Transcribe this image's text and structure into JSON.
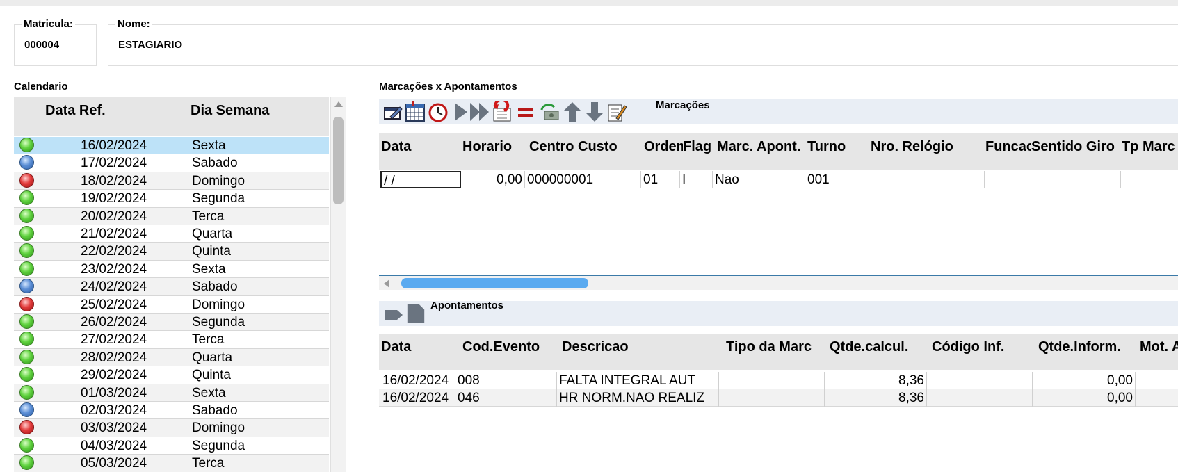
{
  "header": {
    "matricula_label": "Matricula:",
    "matricula_value": "000004",
    "nome_label": "Nome:",
    "nome_value": "ESTAGIARIO"
  },
  "calendar": {
    "title": "Calendario",
    "columns": [
      "Data Ref.",
      "Dia Semana"
    ],
    "rows": [
      {
        "status": "green",
        "date": "16/02/2024",
        "day": "Sexta",
        "selected": true
      },
      {
        "status": "blue",
        "date": "17/02/2024",
        "day": "Sabado"
      },
      {
        "status": "red",
        "date": "18/02/2024",
        "day": "Domingo"
      },
      {
        "status": "green",
        "date": "19/02/2024",
        "day": "Segunda"
      },
      {
        "status": "green",
        "date": "20/02/2024",
        "day": "Terca"
      },
      {
        "status": "green",
        "date": "21/02/2024",
        "day": "Quarta"
      },
      {
        "status": "green",
        "date": "22/02/2024",
        "day": "Quinta"
      },
      {
        "status": "green",
        "date": "23/02/2024",
        "day": "Sexta"
      },
      {
        "status": "blue",
        "date": "24/02/2024",
        "day": "Sabado"
      },
      {
        "status": "red",
        "date": "25/02/2024",
        "day": "Domingo"
      },
      {
        "status": "green",
        "date": "26/02/2024",
        "day": "Segunda"
      },
      {
        "status": "green",
        "date": "27/02/2024",
        "day": "Terca"
      },
      {
        "status": "green",
        "date": "28/02/2024",
        "day": "Quarta"
      },
      {
        "status": "green",
        "date": "29/02/2024",
        "day": "Quinta"
      },
      {
        "status": "green",
        "date": "01/03/2024",
        "day": "Sexta"
      },
      {
        "status": "blue",
        "date": "02/03/2024",
        "day": "Sabado"
      },
      {
        "status": "red",
        "date": "03/03/2024",
        "day": "Domingo"
      },
      {
        "status": "green",
        "date": "04/03/2024",
        "day": "Segunda"
      },
      {
        "status": "green",
        "date": "05/03/2024",
        "day": "Terca"
      }
    ]
  },
  "marcacoes": {
    "section_title": "Marcações x Apontamentos",
    "toolbar_label": "Marcações",
    "toolbar_icons": [
      "edit-icon",
      "calendar-icon",
      "clock-icon",
      "play-icon",
      "fast-forward-icon",
      "undo-icon",
      "equals-icon",
      "refresh-money-icon",
      "arrow-up-icon",
      "arrow-down-icon",
      "notes-icon"
    ],
    "columns": [
      "Data",
      "Horario",
      "Centro Custo",
      "Ordem",
      "Flag",
      "Marc. Apont.",
      "Turno",
      "Nro. Relógio",
      "Funcao",
      "Sentido Giro",
      "Tp Marc"
    ],
    "row": {
      "data": " /  /",
      "horario": "0,00",
      "centro_custo": "000000001",
      "ordem": "01",
      "flag": "I",
      "marc_apont": "Nao",
      "turno": "001",
      "nro_relogio": "",
      "funcao": "",
      "sentido_giro": "",
      "tp_marc": ""
    }
  },
  "apontamentos": {
    "toolbar_label": "Apontamentos",
    "toolbar_icons": [
      "pointer-icon",
      "document-icon"
    ],
    "columns": [
      "Data",
      "Cod.Evento",
      "Descricao",
      "Tipo da Marc",
      "Qtde.calcul.",
      "Código Inf.",
      "Qtde.Inform.",
      "Mot. A"
    ],
    "rows": [
      {
        "data": "16/02/2024",
        "cod": "008",
        "descricao": "FALTA INTEGRAL  AUT",
        "tipo": "",
        "qtde_calc": "8,36",
        "cod_inf": "",
        "qtde_inform": "0,00"
      },
      {
        "data": "16/02/2024",
        "cod": "046",
        "descricao": "HR NORM.NAO REALIZ",
        "tipo": "",
        "qtde_calc": "8,36",
        "cod_inf": "",
        "qtde_inform": "0,00"
      }
    ]
  }
}
